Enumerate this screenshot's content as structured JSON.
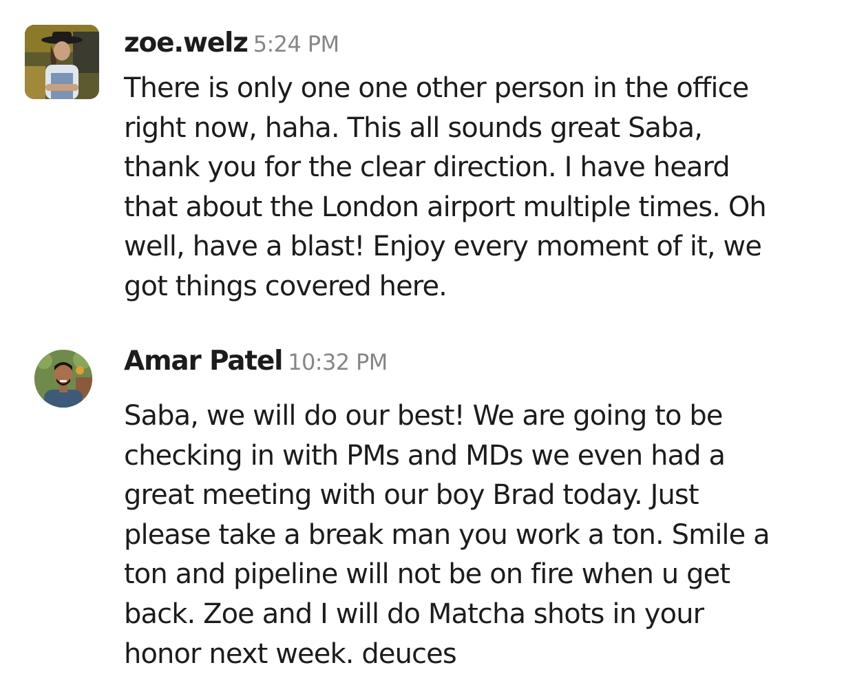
{
  "messages": [
    {
      "author": "zoe.welz",
      "time": "5:24 PM",
      "text": "There is only one one other person in the office\nright now, haha. This all sounds great Saba,\nthank you for the clear direction. I have heard\nthat about the London airport multiple times. Oh\nwell, have a blast! Enjoy every moment of it, we\ngot things covered here."
    },
    {
      "author": "Amar Patel",
      "time": "10:32 PM",
      "text": "Saba, we will do our best! We are going to be\nchecking in with PMs and MDs we even had a\ngreat meeting with our boy Brad today. Just\nplease take a break man you work a ton. Smile a\nton and pipeline will not be on fire when u get\nback. Zoe and I will do Matcha shots in your\nhonor next week. deuces"
    }
  ]
}
